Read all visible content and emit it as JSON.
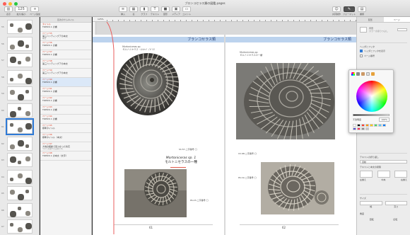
{
  "app": {
    "window_title": "ブロンコセラス類の図鑑.pages"
  },
  "toolbar": {
    "left": [
      {
        "label": "表示",
        "icon": "sidebar-icon"
      },
      {
        "label": "拡大/縮小",
        "icon": "zoom-icon"
      },
      {
        "label": "ページ追加",
        "icon": "add-page-icon"
      }
    ],
    "center": [
      {
        "label": "挿入",
        "icon": "insert-icon"
      },
      {
        "label": "表",
        "icon": "table-icon"
      },
      {
        "label": "グラフ",
        "icon": "chart-icon"
      },
      {
        "label": "テキスト",
        "icon": "text-icon"
      },
      {
        "label": "図形",
        "icon": "shape-icon"
      },
      {
        "label": "メディア",
        "icon": "media-icon"
      },
      {
        "label": "コメント",
        "icon": "comment-icon"
      }
    ],
    "right": [
      {
        "label": "共同制作",
        "icon": "collaborate-icon"
      },
      {
        "label": "フォーマット",
        "icon": "format-icon"
      },
      {
        "label": "書類",
        "icon": "document-icon"
      }
    ]
  },
  "thumbnails": {
    "page_numbers": [
      "55",
      "56",
      "57",
      "58",
      "59",
      "60",
      "61",
      "62",
      "63",
      "64",
      "65",
      "66",
      "67"
    ],
    "selected_index": 6
  },
  "outline": {
    "header": "目次のサムネイル",
    "items": [
      {
        "section": "タイトル",
        "text": "TOPICS 1 の書",
        "sub": ""
      },
      {
        "section": "ページ 55",
        "text": "第三ハンティングアの本文",
        "sub": "本文"
      },
      {
        "section": "ページ 56",
        "text": "TOPICS 1 の書",
        "sub": ""
      },
      {
        "section": "ページ 57",
        "text": "TOPICS 1 の書",
        "sub": ""
      },
      {
        "section": "ページ 58",
        "text": "第三ハンティングアの本文",
        "sub": ""
      },
      {
        "section": "ページ 59",
        "text": "第三ハンティングアの本文",
        "sub": ""
      },
      {
        "section": "ページ 60",
        "text": "TOPICS 1 の書",
        "sub": ""
      },
      {
        "section": "ページ 61",
        "text": "TOPICS 1 の書",
        "sub": ""
      },
      {
        "section": "ページ 62",
        "text": "TOPICS 1 の書",
        "sub": ""
      },
      {
        "section": "ページ 63",
        "text": "TOPICS 1 の書",
        "sub": ""
      },
      {
        "section": "ページ 64",
        "text": "TOPICS 1 の書",
        "sub": ""
      },
      {
        "section": "ページ 65",
        "text": "標準タイトル",
        "sub": ""
      },
      {
        "section": "ページ 66",
        "text": "標準タイトル（本文）",
        "sub": ""
      },
      {
        "section": "ページ 67",
        "text": "大地の観察で見つかった化石",
        "sub": "ついての調べた記録です。"
      },
      {
        "section": "ページ 68",
        "text": "TOPICS 1 の本文（文字）",
        "sub": ""
      }
    ],
    "selected_index": 6
  },
  "canvas": {
    "zoom_label": "125%",
    "left_page": {
      "band_title": "ブランコセラス類",
      "caption_top": "Mortoniceras sp.\nモルトニセラス・ロカイ（ドマ）",
      "caption_mid": "Sh.57-二字番号 ◯",
      "species_title_latin": "Mortoniceras sp. 1",
      "species_title_jp": "モルトニセラスの一種",
      "caption_bottom": "Pb.23-二字番号 ◯",
      "page_number": "61"
    },
    "right_page": {
      "band_title": "ブランコセラス類",
      "caption_top": "Mortoniceras sp.\nモルトニセラスの一種",
      "caption_mid": "Ch.68-二字番号 ◯",
      "caption_low": "Pb.19-二字番号 ◯",
      "page_number": "62"
    }
  },
  "format_panel": {
    "tabs": [
      "配置",
      "ページ"
    ],
    "section_arrange": "配置",
    "background_label": "背景",
    "background_value": "カラーの塗りつぶし",
    "header_footer": "ヘッダとフッタ",
    "header_checkbox": "ヘッダとフッタを表示",
    "header_checked": true,
    "layout_label": "ページ番号",
    "text_wrap_label": "テキストの折り返し",
    "text_wrap_value": "自動",
    "spacing_label": "テキストと本文の間隔",
    "align_labels": [
      "左揃え",
      "中央",
      "右揃え"
    ],
    "size_label": "サイズ",
    "width_label": "幅",
    "height_label": "高さ",
    "angle_label": "角度",
    "bottom_labels": [
      "回転",
      "反転"
    ]
  },
  "color_picker": {
    "opacity_label": "不透明度",
    "opacity_value": "100%",
    "swatches": [
      "#ffffff",
      "#000000",
      "#ff3b30",
      "#ff9500",
      "#ffcc00",
      "#4cd964",
      "#5ac8fa",
      "#007aff",
      "#5856d6",
      "#ff2d55",
      "#8e8e93",
      "#c7c7cc"
    ]
  },
  "colors": {
    "accent": "#2f7ad6",
    "band": "#bcd3ee",
    "band_text": "#1f3c73",
    "guide": "#e85c5c"
  }
}
